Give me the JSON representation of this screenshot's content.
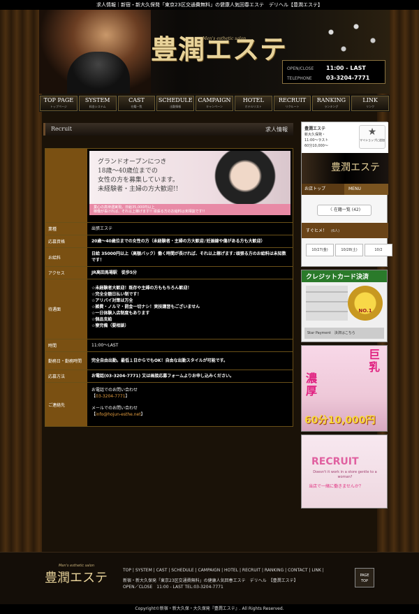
{
  "topbar": {
    "text": "求人情報｜新宿・新大久保発「東京23区交通費無料」の健康人気回春エステ　デリヘル【豊潤エステ】"
  },
  "header": {
    "logo": "豊潤エステ",
    "logo_sub": "Men's esthetic salon",
    "hours_label": "OPEN/CLOSE",
    "hours_value": "11:00 - LAST",
    "tel_label": "TELEPHONE",
    "tel_value": "03-3204-7771"
  },
  "nav": [
    {
      "main": "TOP PAGE",
      "sub": "トップページ"
    },
    {
      "main": "SYSTEM",
      "sub": "料金システム"
    },
    {
      "main": "CAST",
      "sub": "在籍一覧"
    },
    {
      "main": "SCHEDULE",
      "sub": "出勤情報"
    },
    {
      "main": "CAMPAIGN",
      "sub": "キャンペーン"
    },
    {
      "main": "HOTEL",
      "sub": "ホテルリスト"
    },
    {
      "main": "RECRUIT",
      "sub": "リクルート"
    },
    {
      "main": "RANKING",
      "sub": "ランキング"
    },
    {
      "main": "LINK",
      "sub": "リンク"
    }
  ],
  "section": {
    "en": "Recruit",
    "jp": "求人情報"
  },
  "banner": {
    "line1": "グランドオープンにつき",
    "line2": "18歳～40歳位までの",
    "line3": "女性の方を募集しています。",
    "line4": "未経験者・主婦の方大歓迎!!",
    "foot1": "業心の高待遇実現。日給35,000円以上",
    "foot2": "稼働が長ければ、それ以上稼げます!! 頑張る方のお給料は未相談です!!"
  },
  "table": [
    {
      "label": "業種",
      "value": "出張エステ",
      "bold": false
    },
    {
      "label": "応募資格",
      "value": "20歳～40歳位までの女性の方（未経験者・主婦の方大歓迎♪妊娠線や傷がある方も大歓迎）",
      "bold": true
    },
    {
      "label": "お給料",
      "value": "日給 35000円以上（高額バック）働く時間が長ければ、それ以上稼げます♪頑張る方のお給料は未知数です！",
      "bold": true
    },
    {
      "label": "アクセス",
      "value": "JR高田馬場駅　徒歩5分",
      "bold": true
    },
    {
      "label": "待遇面",
      "lines": [
        "☆未経験者大歓迎！既存や主婦の方ももちろん歓迎！",
        "☆完全全額日払い制です！",
        "☆アリバイ対策は万全",
        "☆雑費・ノルマ・罰金一切ナシ！実技講習もございません",
        "☆一日体験入店制度もあります",
        "☆個品支給",
        "☆寮完備（要相談）"
      ]
    },
    {
      "label": "時間",
      "value": "11:00～LAST",
      "bold": false
    },
    {
      "label": "勤務日・勤務時間",
      "value": "完全自由出勤。最低１日からでもOK！自由な出勤スタイルが可能です。",
      "bold": true
    },
    {
      "label": "応募方法",
      "value": "お電話(03-3204-7771) 又は画接応募フォームよりお申し込みください。",
      "bold": true
    },
    {
      "label": "ご連絡先",
      "tel_label": "お電話でのお問い合わせ",
      "tel": "03-3204-7771",
      "mail_label": "メールでのお問い合わせ",
      "mail": "info@hojun-esthe.net"
    }
  ],
  "sidebar": {
    "mini_title": "豊潤エステ",
    "mini_lines": [
      "新大久保発・",
      "11:00～ラスト",
      "60分10,000～"
    ],
    "myshop": "マイショップに追加",
    "mini_banner": "豊潤エステ",
    "nav_a": "お店トップ",
    "nav_b": "MENU",
    "btn": "〈 在籍一覧 (42)",
    "soon": "すぐヒメ！",
    "soon_count": "(6人)",
    "dates": [
      "10/27(金)",
      "10/28(土)",
      "10/2"
    ],
    "credit_head": "クレジットカード決済",
    "credit_medal": "NO.1",
    "credit_foot": "Star Payment　決済はこちら",
    "rich_v1": "濃厚",
    "rich_v2": "巨乳",
    "rich_price": "60分10,000円",
    "recruit_t": "RECRUIT",
    "recruit_s": "Doesn't it work in a store gentle to a woman?",
    "recruit_j": "当店で一緒に働きませんか？"
  },
  "footer": {
    "logo": "豊潤エステ",
    "logo_sub": "Men's esthetic salon",
    "links": "TOP | SYSTEM | CAST | SCHEDULE | CAMPAIGN | HOTEL | RECRUIT | RANKING | CONTACT | LINK |",
    "desc1": "新宿・新大久保発「東京23区交通費無料」の健康人気回春エステ　デリヘル　【豊潤エステ】",
    "desc2": "OPEN／CLOSE　11:00 - LAST TEL:03-3204-7771",
    "pagetop1": "PAGE",
    "pagetop2": "TOP",
    "copyright": "Copyright©新宿・新大久保・大久保発『豊潤エステ』. All Rights Reserved."
  }
}
